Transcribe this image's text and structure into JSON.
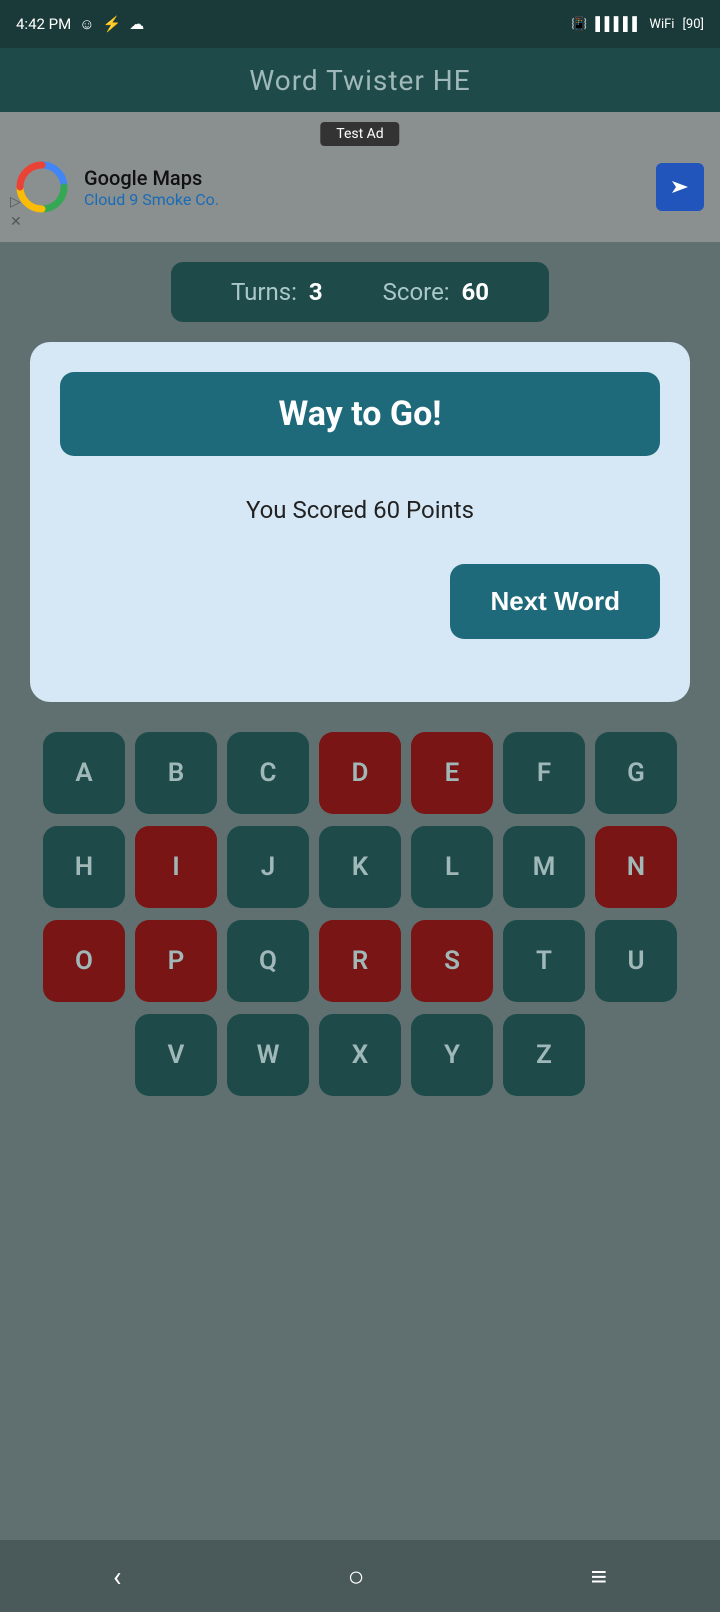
{
  "statusBar": {
    "time": "4:42 PM",
    "battery": "90"
  },
  "appTitle": "Word Twister HE",
  "ad": {
    "testLabel": "Test Ad",
    "businessName": "Google Maps",
    "businessSub": "Cloud 9 Smoke Co."
  },
  "scoreBar": {
    "turnsLabel": "Turns:",
    "turnsValue": "3",
    "scoreLabel": "Score:",
    "scoreValue": "60"
  },
  "dialog": {
    "headerText": "Way to Go!",
    "bodyText": "You Scored 60 Points",
    "nextWordLabel": "Next Word"
  },
  "keyboard": {
    "rows": [
      [
        "A",
        "B",
        "C",
        "D",
        "E",
        "F",
        "G"
      ],
      [
        "H",
        "I",
        "J",
        "K",
        "L",
        "M",
        "N"
      ],
      [
        "O",
        "P",
        "Q",
        "R",
        "S",
        "T",
        "U"
      ],
      [
        "V",
        "W",
        "X",
        "Y",
        "Z"
      ]
    ],
    "usedKeys": [
      "D",
      "E",
      "I",
      "N",
      "O",
      "P",
      "R",
      "S"
    ]
  },
  "navBar": {
    "back": "‹",
    "home": "○",
    "menu": "≡"
  }
}
